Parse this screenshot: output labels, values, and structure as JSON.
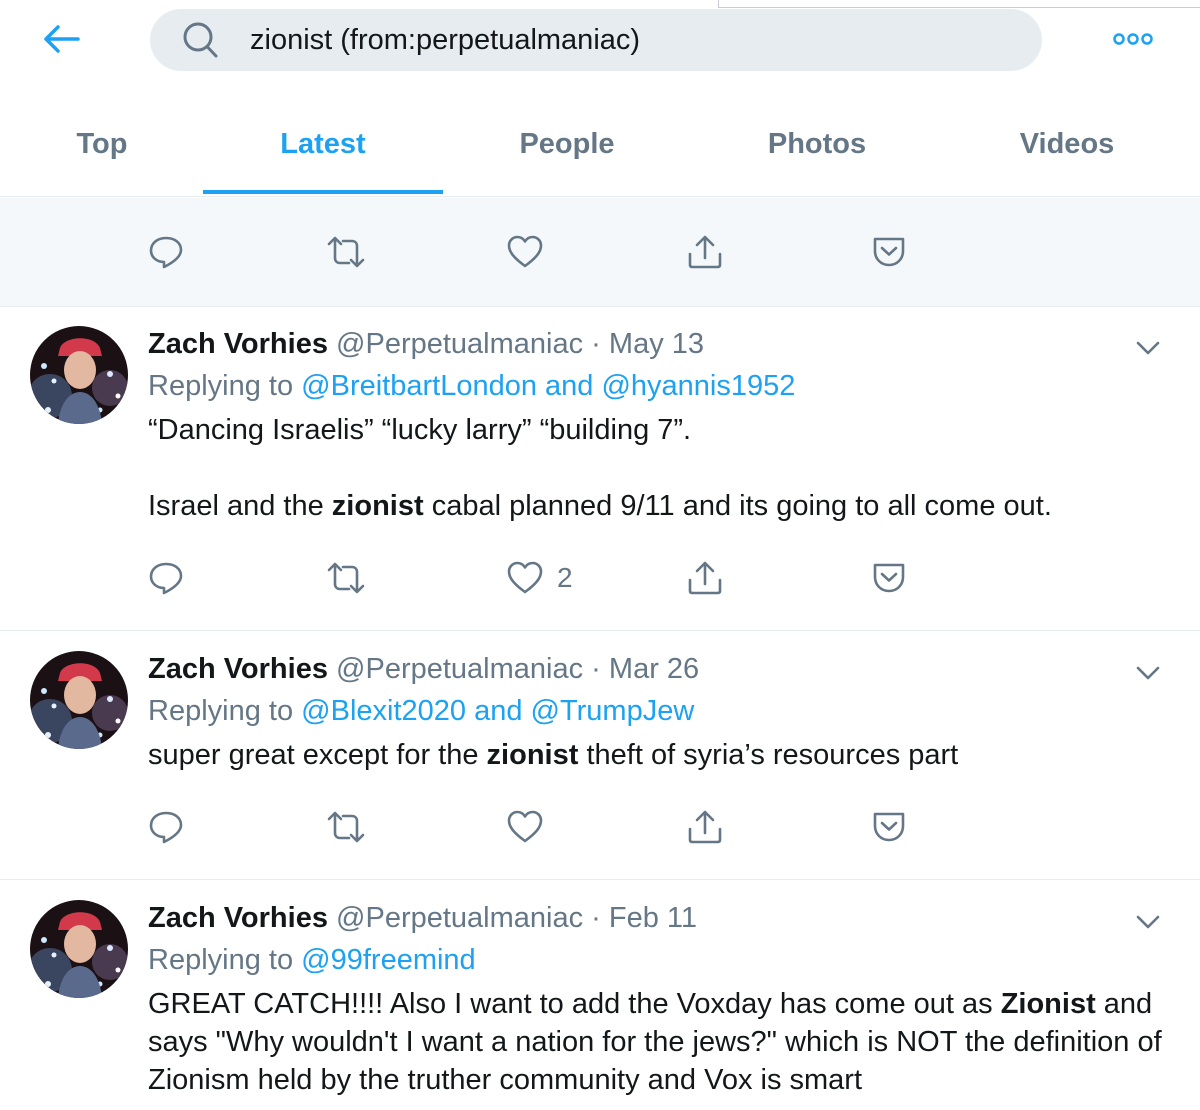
{
  "search": {
    "query": "zionist (from:perpetualmaniac)"
  },
  "tabs": [
    "Top",
    "Latest",
    "People",
    "Photos",
    "Videos"
  ],
  "colors": {
    "accent": "#1da1f2",
    "muted": "#657786",
    "band": "#f5f8fa"
  },
  "tweets": [
    {
      "name": "Zach Vorhies",
      "handle": "@Perpetualmaniac",
      "sep": "·",
      "date": "May 13",
      "reply_prefix": "Replying to",
      "mention1": "@BreitbartLondon",
      "reply_and": "and",
      "mention2": "@hyannis1952",
      "line1": "“Dancing Israelis” “lucky larry” “building 7”.",
      "line2_before": "Israel and the",
      "line2_bold": "zionist",
      "line2_after": "cabal planned 9/11 and its going to all come out.",
      "likes": "2"
    },
    {
      "name": "Zach Vorhies",
      "handle": "@Perpetualmaniac",
      "sep": "·",
      "date": "Mar 26",
      "reply_prefix": "Replying to",
      "mention1": "@Blexit2020",
      "reply_and": "and",
      "mention2": "@TrumpJew",
      "line1_before": "super great except for the",
      "line1_bold": "zionist",
      "line1_after": "theft of syria’s resources part"
    },
    {
      "name": "Zach Vorhies",
      "handle": "@Perpetualmaniac",
      "sep": "·",
      "date": "Feb 11",
      "reply_prefix": "Replying to",
      "mention1": "@99freemind",
      "text_before": "GREAT CATCH!!!! Also I want to add the Voxday has come out as",
      "text_bold": "Zionist",
      "text_after": "and says \"Why wouldn't I want a nation for the jews?\" which is NOT the definition of Zionism held by the truther community and Vox is smart"
    }
  ]
}
